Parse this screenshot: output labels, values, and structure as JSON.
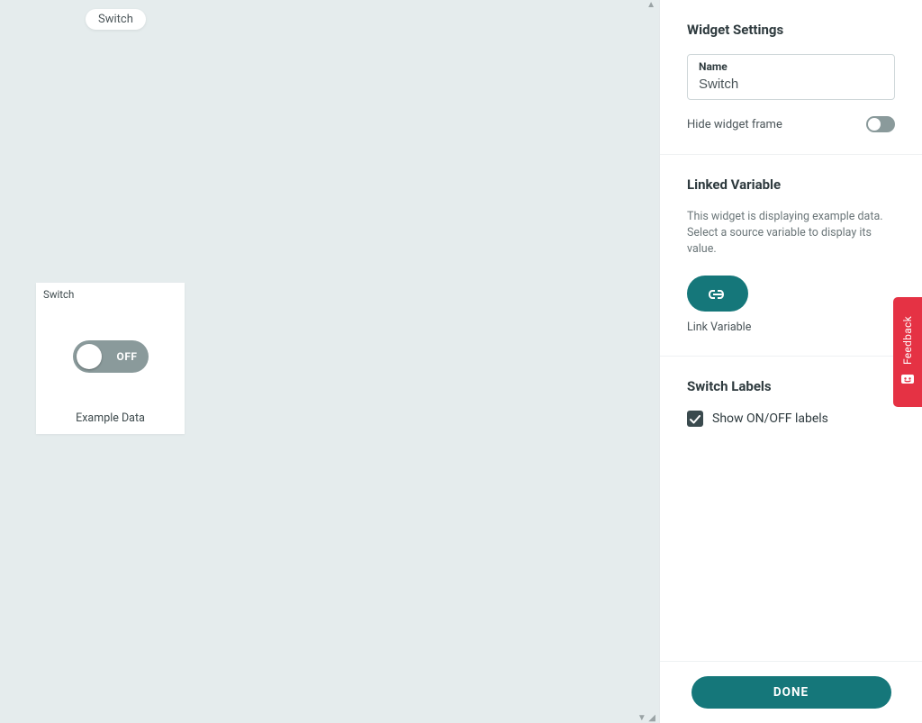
{
  "canvas": {
    "tooltip_label": "Switch",
    "widget_title": "Switch",
    "switch_state_label": "OFF",
    "example_data_label": "Example Data"
  },
  "settings": {
    "heading_widget": "Widget Settings",
    "name_label": "Name",
    "name_value": "Switch",
    "hide_frame_label": "Hide widget frame",
    "heading_linked": "Linked Variable",
    "linked_description": "This widget is displaying example data. Select a source variable to display its value.",
    "link_variable_caption": "Link Variable",
    "heading_switch_labels": "Switch Labels",
    "show_labels_checkbox": "Show ON/OFF labels",
    "done_button": "DONE"
  },
  "feedback": {
    "label": "Feedback"
  },
  "colors": {
    "teal": "#15777a",
    "red": "#e53244",
    "canvas_bg": "#e5eced",
    "toggle_off": "#8a9a9b"
  }
}
